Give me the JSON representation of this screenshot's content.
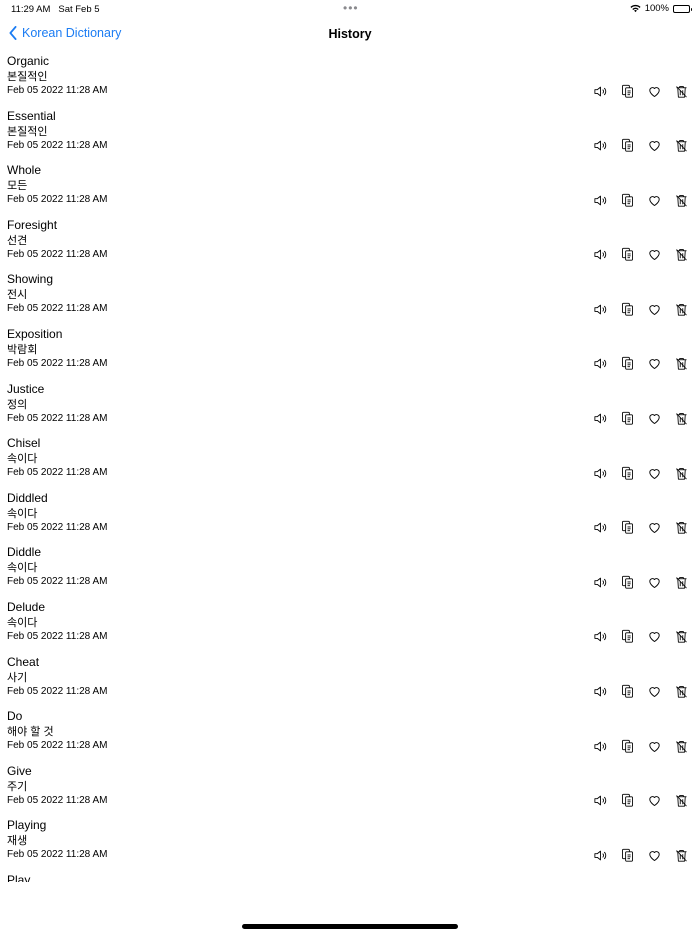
{
  "status": {
    "time": "11:29 AM",
    "date": "Sat Feb 5",
    "battery": "100%"
  },
  "nav": {
    "back_label": "Korean Dictionary",
    "title": "History"
  },
  "entries": [
    {
      "word": "Organic",
      "translation": "본질적인",
      "date": "Feb 05 2022 11:28 AM"
    },
    {
      "word": "Essential",
      "translation": "본질적인",
      "date": "Feb 05 2022 11:28 AM"
    },
    {
      "word": "Whole",
      "translation": "모든",
      "date": "Feb 05 2022 11:28 AM"
    },
    {
      "word": "Foresight",
      "translation": "선견",
      "date": "Feb 05 2022 11:28 AM"
    },
    {
      "word": "Showing",
      "translation": "전시",
      "date": "Feb 05 2022 11:28 AM"
    },
    {
      "word": "Exposition",
      "translation": "박람회",
      "date": "Feb 05 2022 11:28 AM"
    },
    {
      "word": "Justice",
      "translation": "정의",
      "date": "Feb 05 2022 11:28 AM"
    },
    {
      "word": "Chisel",
      "translation": "속이다",
      "date": "Feb 05 2022 11:28 AM"
    },
    {
      "word": "Diddled",
      "translation": "속이다",
      "date": "Feb 05 2022 11:28 AM"
    },
    {
      "word": "Diddle",
      "translation": "속이다",
      "date": "Feb 05 2022 11:28 AM"
    },
    {
      "word": "Delude",
      "translation": "속이다",
      "date": "Feb 05 2022 11:28 AM"
    },
    {
      "word": "Cheat",
      "translation": "사기",
      "date": "Feb 05 2022 11:28 AM"
    },
    {
      "word": "Do",
      "translation": "해야 할 것",
      "date": "Feb 05 2022 11:28 AM"
    },
    {
      "word": "Give",
      "translation": "주기",
      "date": "Feb 05 2022 11:28 AM"
    },
    {
      "word": "Playing",
      "translation": "재생",
      "date": "Feb 05 2022 11:28 AM"
    },
    {
      "word": "Play",
      "translation": "",
      "date": ""
    }
  ],
  "row_actions": [
    "speaker-icon",
    "copy-icon",
    "heart-icon",
    "trash-icon"
  ],
  "colors": {
    "accent": "#1b7cf3"
  }
}
